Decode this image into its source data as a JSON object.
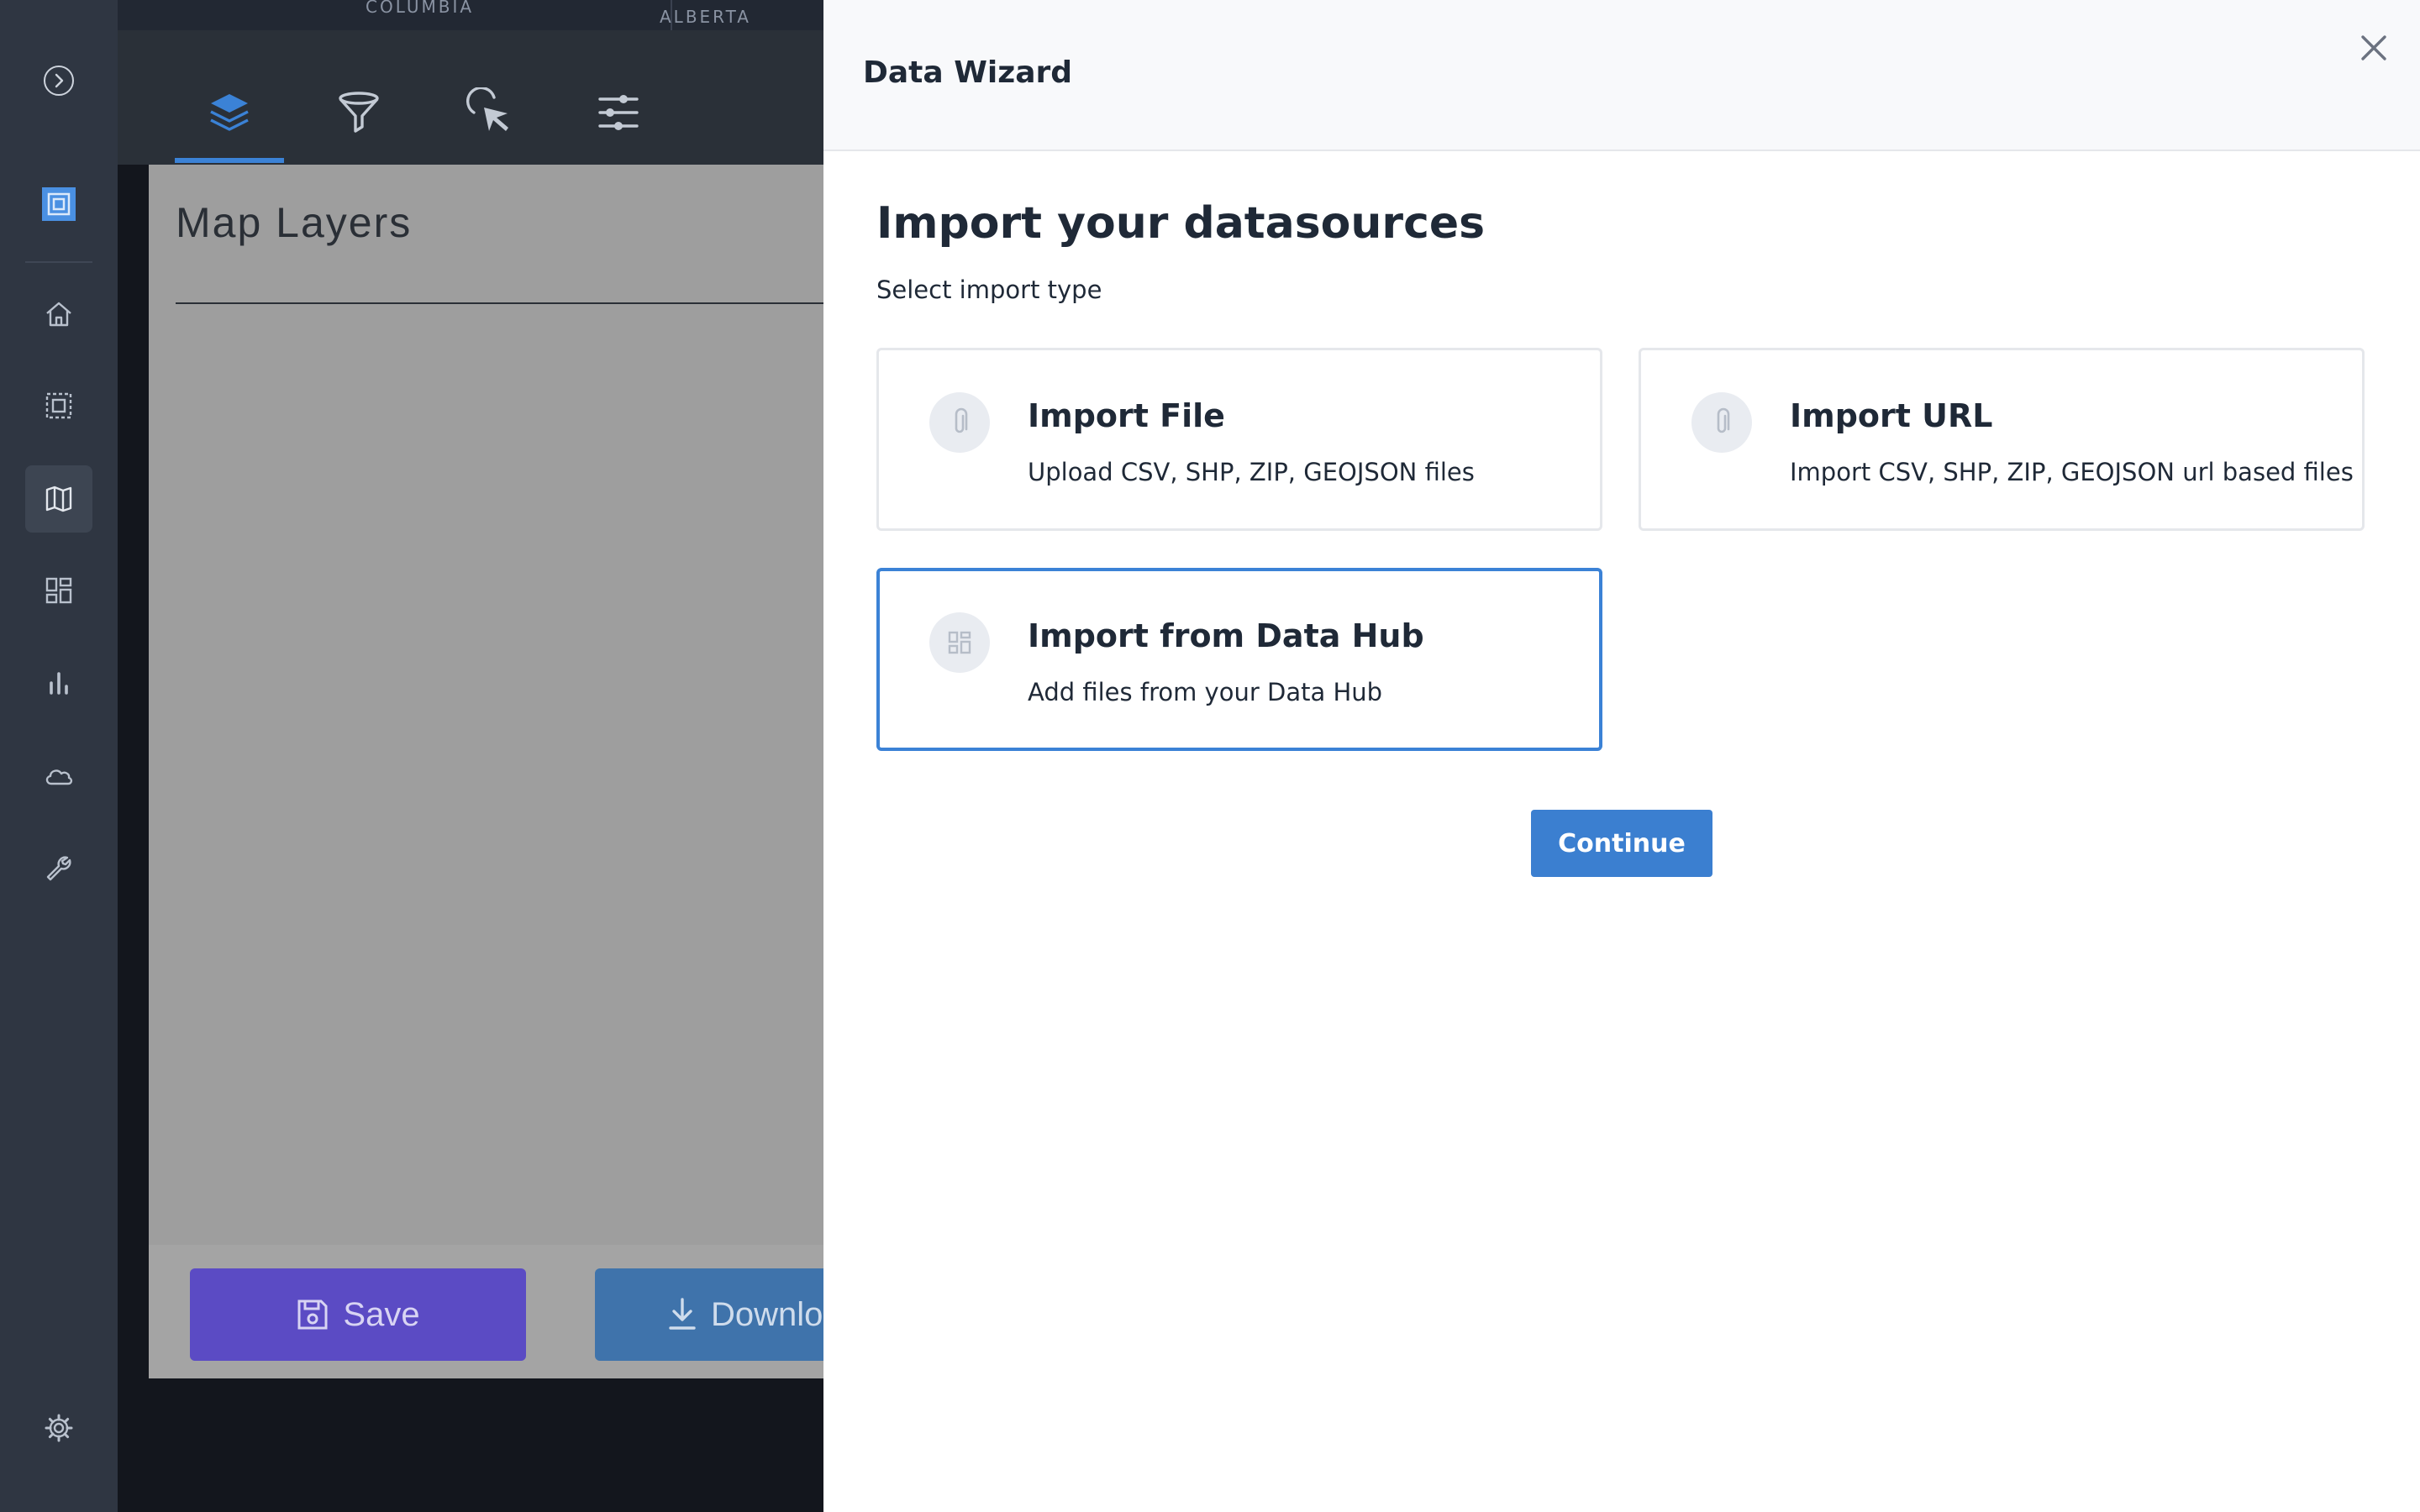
{
  "background": {
    "map_labels": [
      "COLUMBIA",
      "ALBERTA"
    ],
    "panel_title": "Map Layers",
    "save_label": "Save",
    "download_label": "Download"
  },
  "sidebar": {
    "items": [
      {
        "name": "expand",
        "icon": "chevron-right-icon"
      },
      {
        "name": "logo",
        "icon": "logo-icon"
      },
      {
        "name": "home",
        "icon": "home-icon"
      },
      {
        "name": "selection",
        "icon": "select-icon"
      },
      {
        "name": "map",
        "icon": "map-icon"
      },
      {
        "name": "dashboard",
        "icon": "grid-icon"
      },
      {
        "name": "charts",
        "icon": "bar-chart-icon"
      },
      {
        "name": "cloud",
        "icon": "cloud-icon"
      },
      {
        "name": "tools",
        "icon": "wrench-icon"
      },
      {
        "name": "settings",
        "icon": "gear-icon"
      }
    ]
  },
  "toolbar": {
    "tabs": [
      "layers-icon",
      "filter-icon",
      "cursor-icon",
      "sliders-icon"
    ],
    "active_tab": "layers-icon"
  },
  "modal": {
    "title": "Data Wizard",
    "heading": "Import your datasources",
    "subheading": "Select import type",
    "options": [
      {
        "title": "Import File",
        "description": "Upload CSV, SHP, ZIP, GEOJSON files",
        "icon": "paperclip-icon",
        "selected": false
      },
      {
        "title": "Import URL",
        "description": "Import CSV, SHP, ZIP, GEOJSON url based files",
        "icon": "paperclip-icon",
        "selected": false
      },
      {
        "title": "Import from Data Hub",
        "description": "Add files from your Data Hub",
        "icon": "grid-icon",
        "selected": true
      }
    ],
    "continue_label": "Continue"
  },
  "colors": {
    "accent": "#3b7fd0",
    "sidebar": "#2f3642",
    "save_button": "#5b4bc4"
  }
}
